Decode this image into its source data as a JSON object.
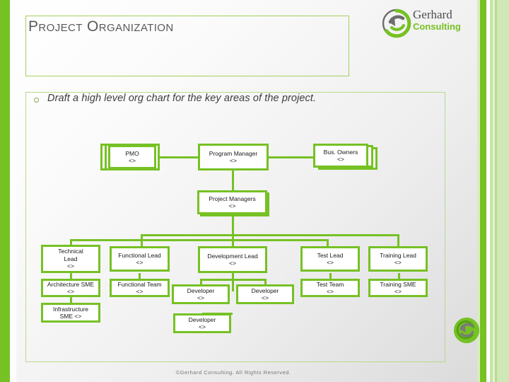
{
  "slide": {
    "title": "Project Organization",
    "footer": "©Gerhard Consulting. All Rights Reserved.",
    "accent_color": "#76c124",
    "title_color": "#595959"
  },
  "brand": {
    "line1": "Gerhard",
    "line2": "Consulting",
    "mark_name": "gerhard-circular-arrow-logo"
  },
  "body": {
    "bullet_glyph": "hollow-circle-bullet",
    "bullet_text": "Draft a high level org chart for the key areas of the project."
  },
  "chart_data": {
    "type": "diagram",
    "title": "Project Organization Chart",
    "nodes": [
      {
        "id": "pmo",
        "title": "PMO",
        "code": "<>",
        "row": 1,
        "stacked": true
      },
      {
        "id": "program-manager",
        "title": "Program Manager",
        "code": "<>",
        "row": 1,
        "stacked": false
      },
      {
        "id": "bus-owners",
        "title": "Bus. Owners",
        "code": "<>",
        "row": 1,
        "stacked": true
      },
      {
        "id": "project-managers",
        "title": "Project Managers",
        "code": "<>",
        "row": 2,
        "stacked": true
      },
      {
        "id": "technical-lead",
        "title": "Technical\nLead",
        "code": "<>",
        "row": 3,
        "stacked": false
      },
      {
        "id": "functional-lead",
        "title": "Functional Lead",
        "code": "<>",
        "row": 3,
        "stacked": false
      },
      {
        "id": "development-lead",
        "title": "Development Lead",
        "code": "<>",
        "row": 3,
        "stacked": false
      },
      {
        "id": "test-lead",
        "title": "Test Lead",
        "code": "<>",
        "row": 3,
        "stacked": false
      },
      {
        "id": "training-lead",
        "title": "Training Lead",
        "code": "<>",
        "row": 3,
        "stacked": false
      },
      {
        "id": "architecture-sme",
        "title": "Architecture SME",
        "code": "<>",
        "row": 4,
        "stacked": false
      },
      {
        "id": "functional-team",
        "title": "Functional Team",
        "code": "<>",
        "row": 4,
        "stacked": false
      },
      {
        "id": "developer-1",
        "title": "Developer",
        "code": "<>",
        "row": 4,
        "stacked": false
      },
      {
        "id": "developer-2",
        "title": "Developer",
        "code": "<>",
        "row": 4,
        "stacked": false
      },
      {
        "id": "test-team",
        "title": "Test Team",
        "code": "<>",
        "row": 4,
        "stacked": false
      },
      {
        "id": "training-sme",
        "title": "Training SME",
        "code": "<>",
        "row": 4,
        "stacked": false
      },
      {
        "id": "infrastructure-sme",
        "title": "Infrastructure\nSME <>",
        "code": "",
        "row": 5,
        "stacked": false
      },
      {
        "id": "developer-3",
        "title": "Developer",
        "code": "<>",
        "row": 5,
        "stacked": false
      }
    ],
    "edges": [
      {
        "from": "pmo",
        "to": "program-manager"
      },
      {
        "from": "program-manager",
        "to": "bus-owners"
      },
      {
        "from": "program-manager",
        "to": "project-managers"
      },
      {
        "from": "project-managers",
        "to": "technical-lead"
      },
      {
        "from": "project-managers",
        "to": "functional-lead"
      },
      {
        "from": "project-managers",
        "to": "development-lead"
      },
      {
        "from": "project-managers",
        "to": "test-lead"
      },
      {
        "from": "project-managers",
        "to": "training-lead"
      },
      {
        "from": "technical-lead",
        "to": "architecture-sme"
      },
      {
        "from": "architecture-sme",
        "to": "infrastructure-sme"
      },
      {
        "from": "functional-lead",
        "to": "functional-team"
      },
      {
        "from": "development-lead",
        "to": "developer-1"
      },
      {
        "from": "development-lead",
        "to": "developer-2"
      },
      {
        "from": "development-lead",
        "to": "developer-3"
      },
      {
        "from": "test-lead",
        "to": "test-team"
      },
      {
        "from": "training-lead",
        "to": "training-sme"
      }
    ]
  }
}
